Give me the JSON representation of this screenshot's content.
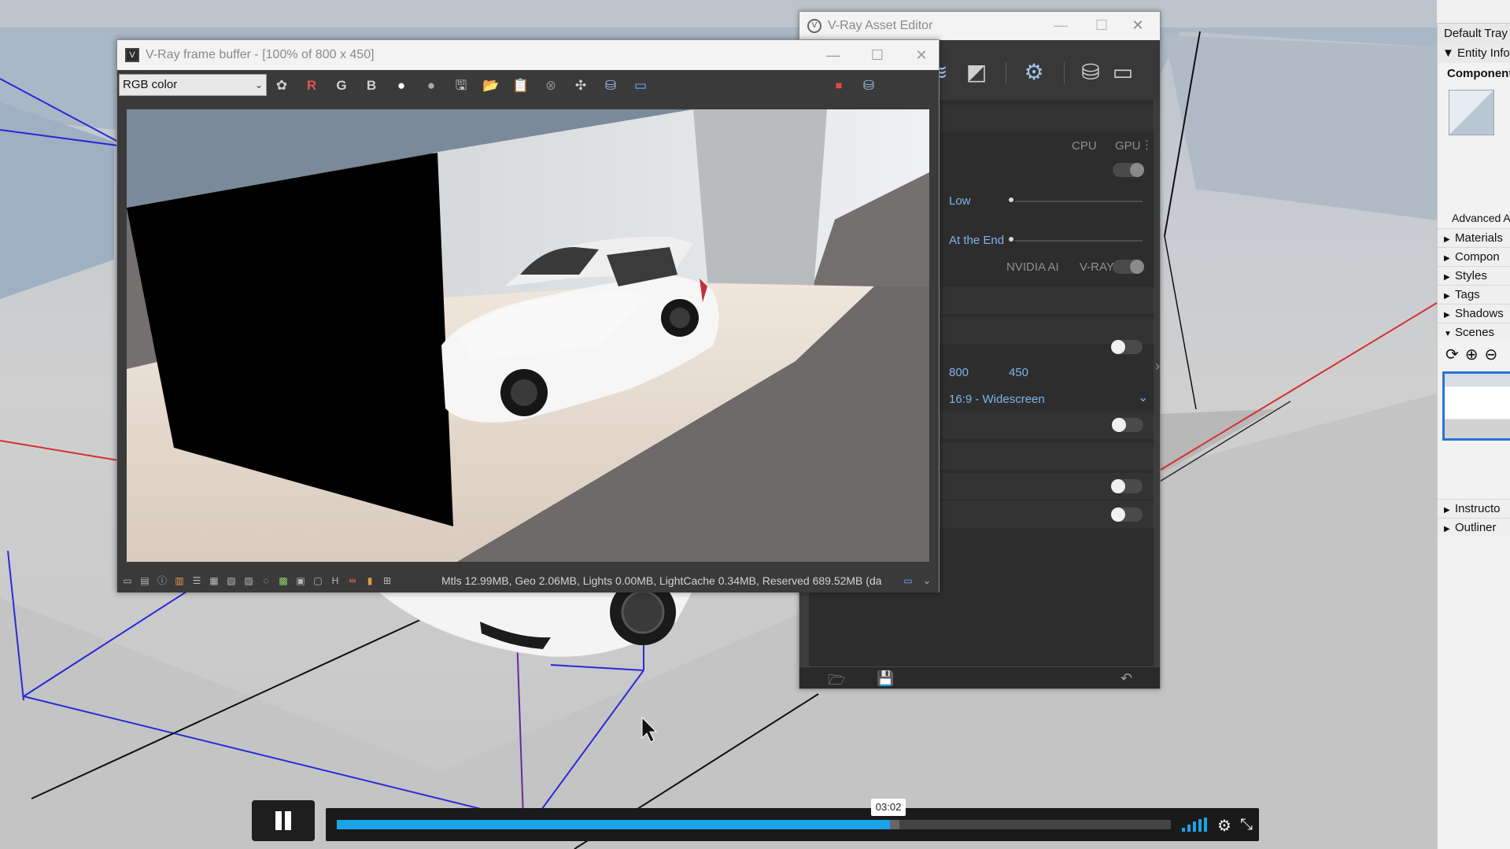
{
  "colors": {
    "accent_blue": "#7fb4e8",
    "progress": "#1aa3e8",
    "selection": "#2b73d6"
  },
  "frame_buffer": {
    "title": "V-Ray frame buffer - [100% of 800 x 450]",
    "channel_select": "RGB color",
    "toolbar": {
      "r": "R",
      "g": "G",
      "b": "B",
      "h": "H"
    },
    "status_text": "Mtls 12.99MB, Geo 2.06MB, Lights 0.00MB, LightCache 0.34MB, Reserved 689.52MB (da"
  },
  "asset_editor": {
    "title": "V-Ray Asset Editor",
    "cpu": "CPU",
    "gpu": "GPU",
    "quality_value": "Low",
    "update_value": "At the End",
    "denoiser_nvidia": "NVIDIA AI",
    "denoiser_vray": "V-RAY",
    "width": "800",
    "height": "450",
    "aspect": "16:9 - Widescreen"
  },
  "tray": {
    "title": "Default Tray",
    "entity_info": "Entity Info",
    "component": "Component",
    "advanced": "Advanced A",
    "items": [
      "Materials",
      "Compon",
      "Styles",
      "Tags",
      "Shadows"
    ],
    "scenes": "Scenes",
    "bottom_items": [
      "Instructo",
      "Outliner"
    ]
  },
  "player": {
    "time": "03:02",
    "progress_fraction": 0.663,
    "buffer_fraction": 0.675
  }
}
